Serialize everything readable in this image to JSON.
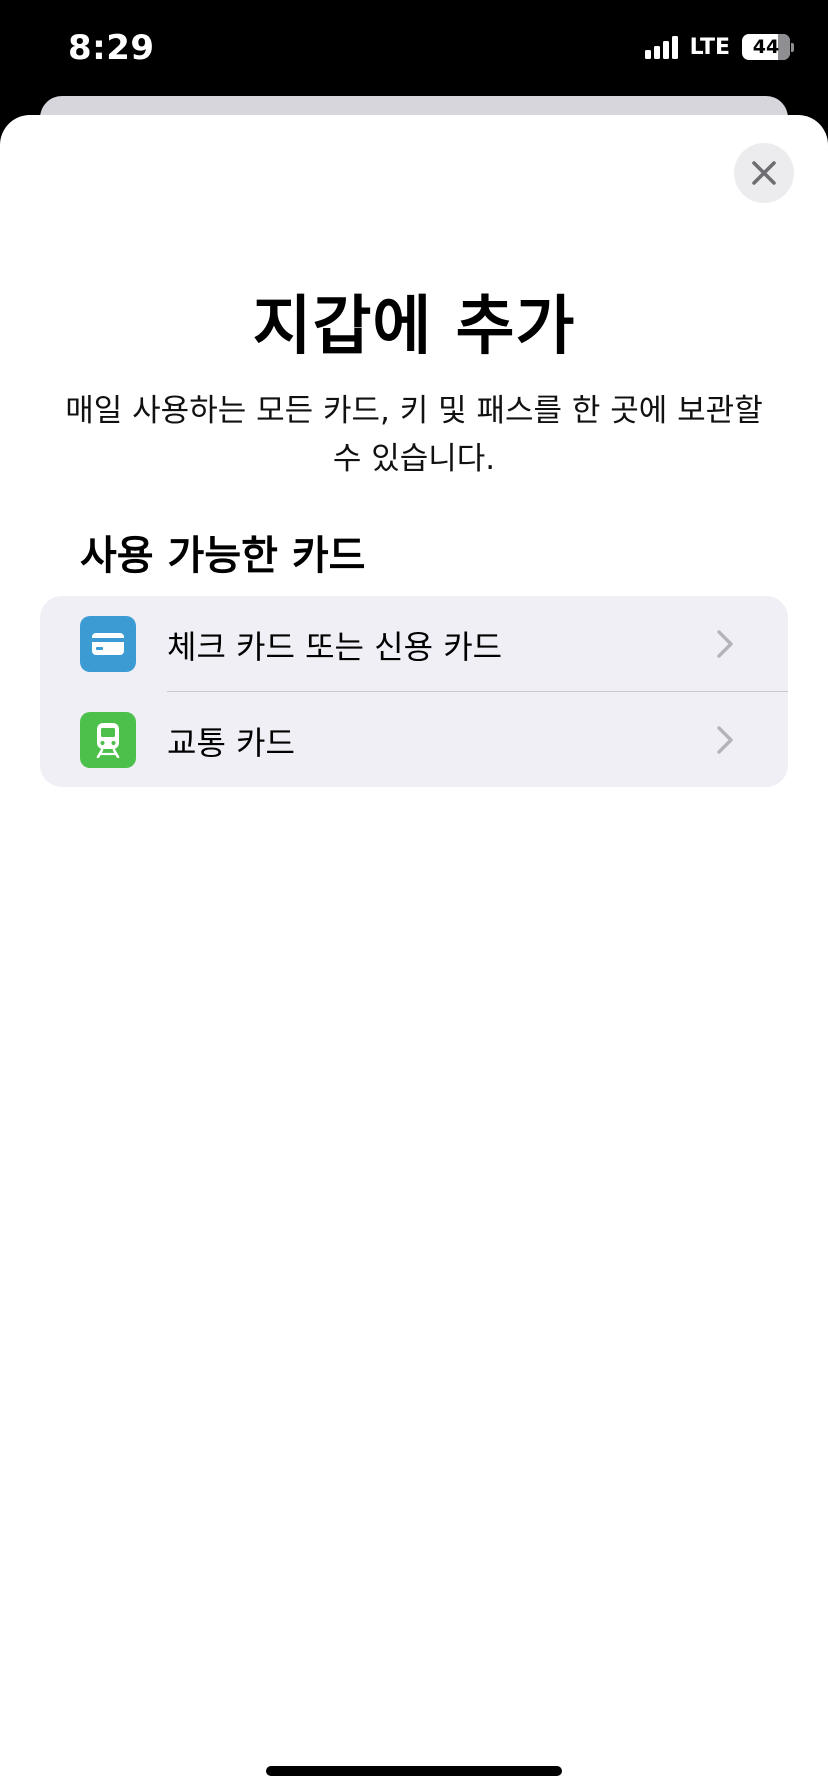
{
  "status_bar": {
    "time": "8:29",
    "network": "LTE",
    "battery_level": "44",
    "signal_bars": 4
  },
  "sheet": {
    "close_icon": "close-icon",
    "title": "지갑에 추가",
    "subtitle": "매일 사용하는 모든 카드, 키 및 패스를 한 곳에 보관할 수 있습니다.",
    "section_title": "사용 가능한 카드",
    "items": [
      {
        "label": "체크 카드 또는 신용 카드",
        "icon": "credit-card-icon",
        "icon_color": "#3d9bd4"
      },
      {
        "label": "교통 카드",
        "icon": "train-icon",
        "icon_color": "#4cc04a"
      }
    ]
  },
  "colors": {
    "sheet_background": "#ffffff",
    "list_background": "#efeff5",
    "close_button_background": "#ececee",
    "chevron": "#b4b4ba"
  }
}
